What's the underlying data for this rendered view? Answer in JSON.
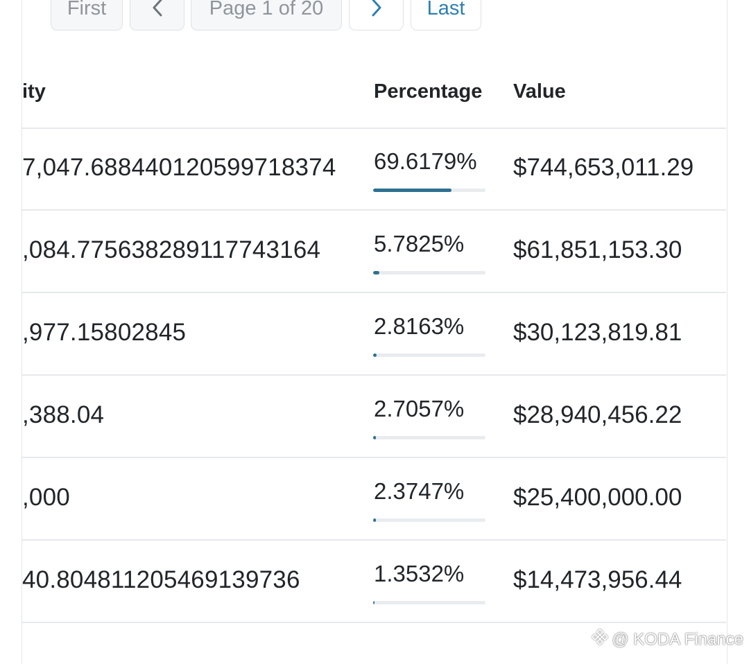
{
  "pagination": {
    "first_label": "First",
    "prev_icon": "chevron-left-icon",
    "page_info": "Page 1 of 20",
    "next_icon": "chevron-right-icon",
    "last_label": "Last"
  },
  "table": {
    "headers": {
      "quantity": "ity",
      "percentage": "Percentage",
      "value": "Value"
    },
    "rows": [
      {
        "quantity": "7,047.688440120599718374",
        "percentage": "69.6179%",
        "percent_value": 69.6179,
        "value": "$744,653,011.29"
      },
      {
        "quantity": ",084.775638289117743164",
        "percentage": "5.7825%",
        "percent_value": 5.7825,
        "value": "$61,851,153.30"
      },
      {
        "quantity": ",977.15802845",
        "percentage": "2.8163%",
        "percent_value": 2.8163,
        "value": "$30,123,819.81"
      },
      {
        "quantity": ",388.04",
        "percentage": "2.7057%",
        "percent_value": 2.7057,
        "value": "$28,940,456.22"
      },
      {
        "quantity": ",000",
        "percentage": "2.3747%",
        "percent_value": 2.3747,
        "value": "$25,400,000.00"
      },
      {
        "quantity": "40.804811205469139736",
        "percentage": "1.3532%",
        "percent_value": 1.3532,
        "value": "$14,473,956.44"
      }
    ]
  },
  "colors": {
    "accent": "#2e7fae",
    "bar_fill": "#2d7092",
    "bar_track": "#e9ecef",
    "divider": "#e6e9ec"
  },
  "watermark": {
    "text": "@ KODA Finance",
    "icon": "binance-logo-icon"
  }
}
